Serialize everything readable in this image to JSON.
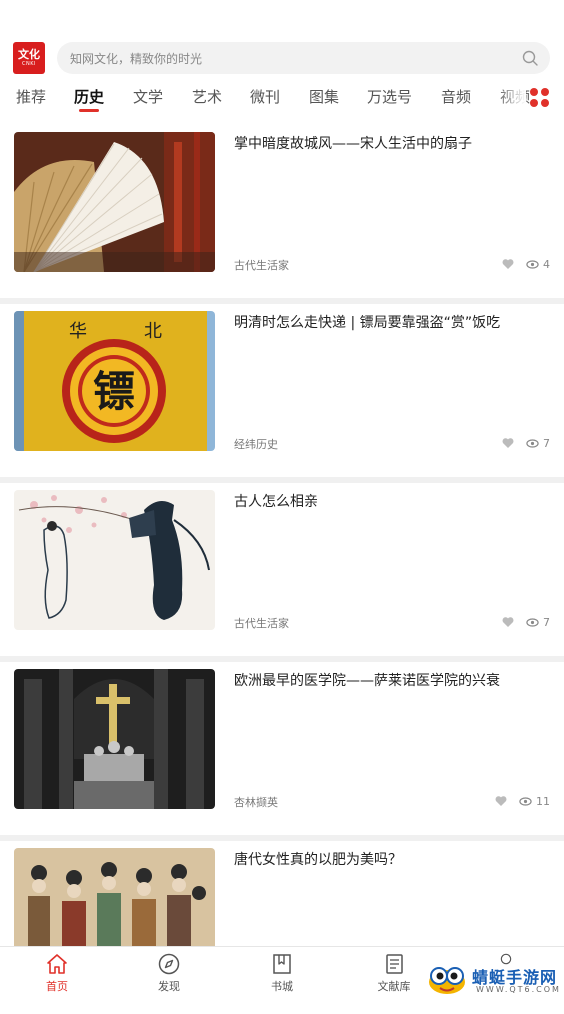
{
  "header": {
    "logo_text": "文化",
    "logo_sub": "CNKI",
    "search_placeholder": "知网文化，精致你的时光"
  },
  "tabs": [
    {
      "label": "推荐"
    },
    {
      "label": "历史",
      "active": true
    },
    {
      "label": "文学"
    },
    {
      "label": "艺术"
    },
    {
      "label": "微刊"
    },
    {
      "label": "图集"
    },
    {
      "label": "万选号"
    },
    {
      "label": "音频"
    },
    {
      "label": "视频"
    }
  ],
  "articles": [
    {
      "title": "掌中暗度故城风——宋人生活中的扇子",
      "source": "古代生活家",
      "views": "4",
      "image": "folding-fan-photo"
    },
    {
      "title": "明清时怎么走快递 | 镖局要靠强盗“赏”饭吃",
      "source": "经纬历史",
      "views": "7",
      "image": "escort-banner-photo"
    },
    {
      "title": "古人怎么相亲",
      "source": "古代生活家",
      "views": "7",
      "image": "ancient-ink-painting"
    },
    {
      "title": "欧洲最早的医学院——萨莱诺医学院的兴衰",
      "source": "杏林撷英",
      "views": "11",
      "image": "cathedral-interior-photo"
    },
    {
      "title": "唐代女性真的以肥为美吗？",
      "source": "",
      "views": "",
      "image": "tang-mural-painting"
    }
  ],
  "bottom_nav": [
    {
      "label": "首页",
      "icon": "home-icon",
      "active": true
    },
    {
      "label": "发现",
      "icon": "compass-icon"
    },
    {
      "label": "书城",
      "icon": "bookmark-book-icon"
    },
    {
      "label": "文献库",
      "icon": "document-icon"
    },
    {
      "label": "",
      "icon": "profile-icon"
    }
  ],
  "watermark": {
    "title": "蜻蜓手游网",
    "url": "WWW.QT6.COM"
  },
  "colors": {
    "accent": "#e0312a",
    "logo_bg": "#d81e1e"
  }
}
